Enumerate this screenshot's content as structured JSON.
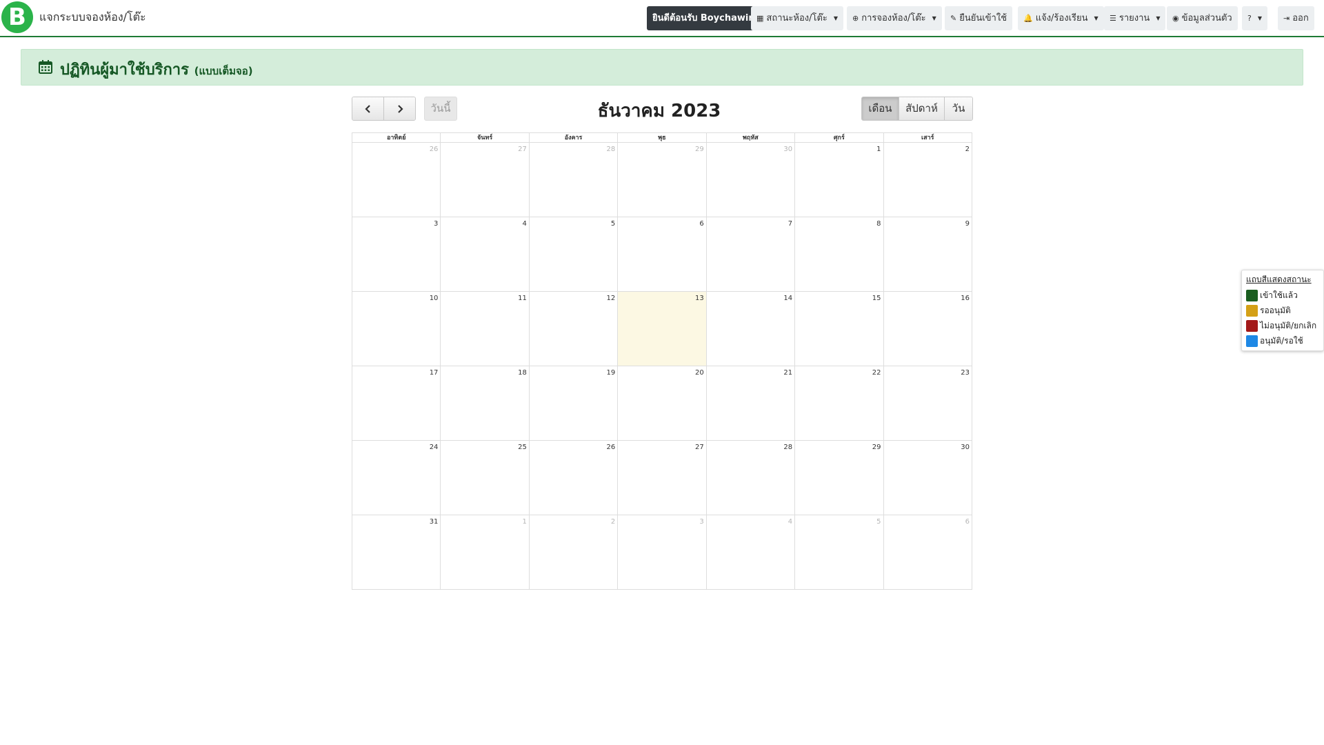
{
  "app": {
    "logo_letter": "B",
    "brand": "แจกระบบจองห้อง/โต๊ะ"
  },
  "navbar": {
    "welcome": "ยินดีต้อนรับ Boychawin",
    "room_status": "สถานะห้อง/โต๊ะ",
    "booking": "การจองห้อง/โต๊ะ",
    "confirm_use": "ยืนยันเข้าใช้",
    "report_issue": "แจ้ง/ร้องเรียน",
    "reports": "รายงาน",
    "profile": "ข้อมูลส่วนตัว",
    "help": "?",
    "logout": "ออก"
  },
  "page": {
    "title": "ปฏิทินผู้มาใช้บริการ",
    "subtitle": "(แบบเต็มจอ)"
  },
  "toolbar": {
    "prev_icon": "chevron-left-icon",
    "next_icon": "chevron-right-icon",
    "today": "วันนี้",
    "title": "ธันวาคม 2023",
    "views": [
      "เดือน",
      "สัปดาห์",
      "วัน"
    ],
    "active_view": "เดือน"
  },
  "calendar": {
    "weekdays": [
      "อาทิตย์",
      "จันทร์",
      "อังคาร",
      "พุธ",
      "พฤหัส",
      "ศุกร์",
      "เสาร์"
    ],
    "weeks": [
      [
        {
          "d": "26",
          "other": true
        },
        {
          "d": "27",
          "other": true
        },
        {
          "d": "28",
          "other": true
        },
        {
          "d": "29",
          "other": true
        },
        {
          "d": "30",
          "other": true
        },
        {
          "d": "1"
        },
        {
          "d": "2"
        }
      ],
      [
        {
          "d": "3"
        },
        {
          "d": "4"
        },
        {
          "d": "5"
        },
        {
          "d": "6"
        },
        {
          "d": "7"
        },
        {
          "d": "8"
        },
        {
          "d": "9"
        }
      ],
      [
        {
          "d": "10"
        },
        {
          "d": "11"
        },
        {
          "d": "12"
        },
        {
          "d": "13",
          "today": true
        },
        {
          "d": "14"
        },
        {
          "d": "15"
        },
        {
          "d": "16"
        }
      ],
      [
        {
          "d": "17"
        },
        {
          "d": "18"
        },
        {
          "d": "19"
        },
        {
          "d": "20"
        },
        {
          "d": "21"
        },
        {
          "d": "22"
        },
        {
          "d": "23"
        }
      ],
      [
        {
          "d": "24"
        },
        {
          "d": "25"
        },
        {
          "d": "26"
        },
        {
          "d": "27"
        },
        {
          "d": "28"
        },
        {
          "d": "29"
        },
        {
          "d": "30"
        }
      ],
      [
        {
          "d": "31"
        },
        {
          "d": "1",
          "other": true
        },
        {
          "d": "2",
          "other": true
        },
        {
          "d": "3",
          "other": true
        },
        {
          "d": "4",
          "other": true
        },
        {
          "d": "5",
          "other": true
        },
        {
          "d": "6",
          "other": true
        }
      ]
    ]
  },
  "legend": {
    "title": "แถบสีแสดงสถานะ",
    "items": [
      {
        "label": "เข้าใช้แล้ว",
        "color": "#1b5e20"
      },
      {
        "label": "รออนุมัติ",
        "color": "#d4a017"
      },
      {
        "label": "ไม่อนุมัติ/ยกเลิก",
        "color": "#a31919"
      },
      {
        "label": "อนุมัติ/รอใช้",
        "color": "#1e88e5"
      }
    ]
  },
  "colors": {
    "accent": "#1e7a34",
    "header_bg": "#d4edda",
    "today_bg": "#fcf8e3"
  }
}
